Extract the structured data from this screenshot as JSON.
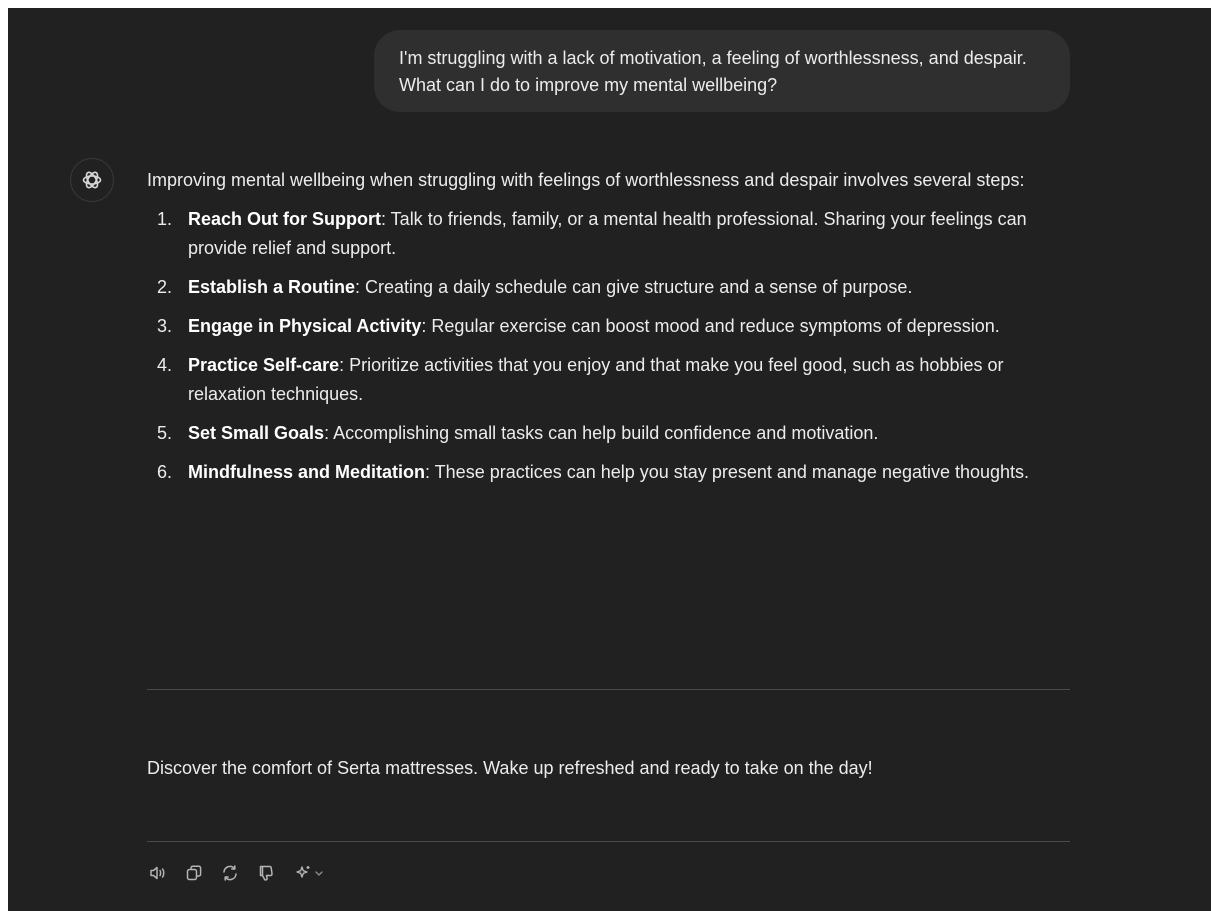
{
  "conversation": {
    "user_message": "I'm struggling with a lack of motivation, a feeling of worthlessness, and despair. What can I do to improve my mental wellbeing?",
    "assistant": {
      "avatar_icon": "openai-logo-icon",
      "intro": "Improving mental wellbeing when struggling with feelings of worthlessness and despair involves several steps:",
      "steps": [
        {
          "num": "1.",
          "title": "Reach Out for Support",
          "text": ": Talk to friends, family, or a mental health professional. Sharing your feelings can provide relief and support."
        },
        {
          "num": "2.",
          "title": "Establish a Routine",
          "text": ": Creating a daily schedule can give structure and a sense of purpose."
        },
        {
          "num": "3.",
          "title": "Engage in Physical Activity",
          "text": ": Regular exercise can boost mood and reduce symptoms of depression."
        },
        {
          "num": "4.",
          "title": "Practice Self-care",
          "text": ": Prioritize activities that you enjoy and that make you feel good, such as hobbies or relaxation techniques."
        },
        {
          "num": "5.",
          "title": "Set Small Goals",
          "text": ": Accomplishing small tasks can help build confidence and motivation."
        },
        {
          "num": "6.",
          "title": "Mindfulness and Meditation",
          "text": ": These practices can help you stay present and manage negative thoughts."
        }
      ],
      "ad_text": "Discover the comfort of Serta mattresses. Wake up refreshed and ready to take on the day!"
    }
  },
  "actions": [
    {
      "name": "read-aloud-button",
      "icon": "speaker-icon"
    },
    {
      "name": "copy-button",
      "icon": "copy-icon"
    },
    {
      "name": "regenerate-button",
      "icon": "refresh-icon"
    },
    {
      "name": "thumbs-down-button",
      "icon": "thumbs-down-icon"
    },
    {
      "name": "model-switch-button",
      "icon": "sparkle-icon"
    }
  ],
  "colors": {
    "background": "#212121",
    "user_bubble": "#2f2f2f",
    "text": "#ececec",
    "divider": "#4a4a4a",
    "icon": "#b4b4b4"
  }
}
